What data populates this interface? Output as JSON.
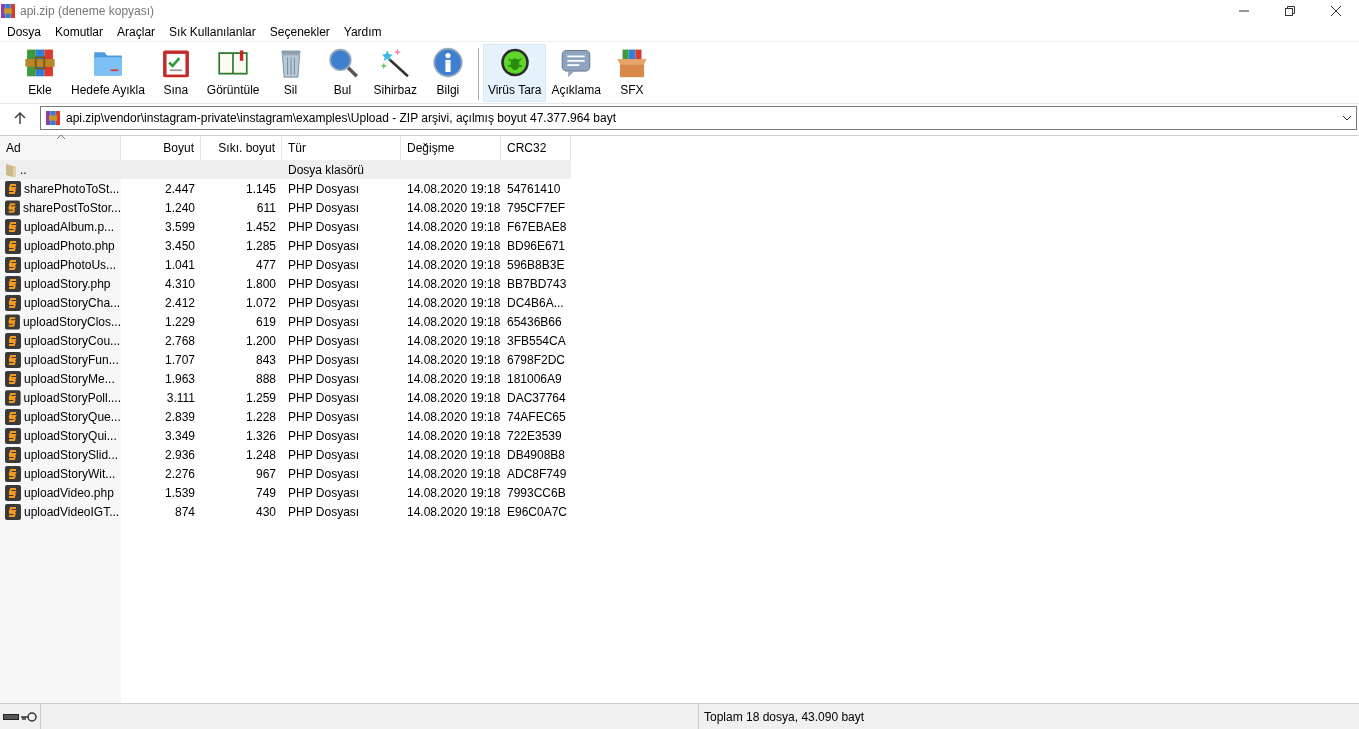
{
  "window": {
    "title": "api.zip (deneme kopyası)"
  },
  "menu": [
    "Dosya",
    "Komutlar",
    "Araçlar",
    "Sık Kullanılanlar",
    "Seçenekler",
    "Yardım"
  ],
  "toolbar": [
    {
      "label": "Ekle",
      "selected": false
    },
    {
      "label": "Hedefe Ayıkla",
      "selected": false
    },
    {
      "label": "Sına",
      "selected": false
    },
    {
      "label": "Görüntüle",
      "selected": false
    },
    {
      "label": "Sil",
      "selected": false
    },
    {
      "label": "Bul",
      "selected": false
    },
    {
      "label": "Sihirbaz",
      "selected": false
    },
    {
      "label": "Bilgi",
      "selected": false
    },
    {
      "label": "Virüs Tara",
      "selected": true
    },
    {
      "label": "Açıklama",
      "selected": false
    },
    {
      "label": "SFX",
      "selected": false
    }
  ],
  "address": {
    "value": "api.zip\\vendor\\instagram-private\\instagram\\examples\\Upload - ZIP arşivi, açılmış boyut 47.377.964 bayt"
  },
  "table": {
    "columns": [
      {
        "label": "Ad",
        "sorted": true
      },
      {
        "label": "Boyut",
        "sorted": false
      },
      {
        "label": "Sıkı. boyut",
        "sorted": false
      },
      {
        "label": "Tür",
        "sorted": false
      },
      {
        "label": "Değişme",
        "sorted": false
      },
      {
        "label": "CRC32",
        "sorted": false
      }
    ],
    "rows": [
      {
        "kind": "folder",
        "selected": true,
        "cells": [
          "..",
          "",
          "",
          "Dosya klasörü",
          "",
          ""
        ]
      },
      {
        "kind": "file",
        "selected": false,
        "cells": [
          "sharePhotoToSt...",
          "2.447",
          "1.145",
          "PHP Dosyası",
          "14.08.2020 19:18",
          "54761410"
        ]
      },
      {
        "kind": "file",
        "selected": false,
        "cells": [
          "sharePostToStor...",
          "1.240",
          "611",
          "PHP Dosyası",
          "14.08.2020 19:18",
          "795CF7EF"
        ]
      },
      {
        "kind": "file",
        "selected": false,
        "cells": [
          "uploadAlbum.p...",
          "3.599",
          "1.452",
          "PHP Dosyası",
          "14.08.2020 19:18",
          "F67EBAE8"
        ]
      },
      {
        "kind": "file",
        "selected": false,
        "cells": [
          "uploadPhoto.php",
          "3.450",
          "1.285",
          "PHP Dosyası",
          "14.08.2020 19:18",
          "BD96E671"
        ]
      },
      {
        "kind": "file",
        "selected": false,
        "cells": [
          "uploadPhotoUs...",
          "1.041",
          "477",
          "PHP Dosyası",
          "14.08.2020 19:18",
          "596B8B3E"
        ]
      },
      {
        "kind": "file",
        "selected": false,
        "cells": [
          "uploadStory.php",
          "4.310",
          "1.800",
          "PHP Dosyası",
          "14.08.2020 19:18",
          "BB7BD743"
        ]
      },
      {
        "kind": "file",
        "selected": false,
        "cells": [
          "uploadStoryCha...",
          "2.412",
          "1.072",
          "PHP Dosyası",
          "14.08.2020 19:18",
          "DC4B6A..."
        ]
      },
      {
        "kind": "file",
        "selected": false,
        "cells": [
          "uploadStoryClos...",
          "1.229",
          "619",
          "PHP Dosyası",
          "14.08.2020 19:18",
          "65436B66"
        ]
      },
      {
        "kind": "file",
        "selected": false,
        "cells": [
          "uploadStoryCou...",
          "2.768",
          "1.200",
          "PHP Dosyası",
          "14.08.2020 19:18",
          "3FB554CA"
        ]
      },
      {
        "kind": "file",
        "selected": false,
        "cells": [
          "uploadStoryFun...",
          "1.707",
          "843",
          "PHP Dosyası",
          "14.08.2020 19:18",
          "6798F2DC"
        ]
      },
      {
        "kind": "file",
        "selected": false,
        "cells": [
          "uploadStoryMe...",
          "1.963",
          "888",
          "PHP Dosyası",
          "14.08.2020 19:18",
          "181006A9"
        ]
      },
      {
        "kind": "file",
        "selected": false,
        "cells": [
          "uploadStoryPoll....",
          "3.111",
          "1.259",
          "PHP Dosyası",
          "14.08.2020 19:18",
          "DAC37764"
        ]
      },
      {
        "kind": "file",
        "selected": false,
        "cells": [
          "uploadStoryQue...",
          "2.839",
          "1.228",
          "PHP Dosyası",
          "14.08.2020 19:18",
          "74AFEC65"
        ]
      },
      {
        "kind": "file",
        "selected": false,
        "cells": [
          "uploadStoryQui...",
          "3.349",
          "1.326",
          "PHP Dosyası",
          "14.08.2020 19:18",
          "722E3539"
        ]
      },
      {
        "kind": "file",
        "selected": false,
        "cells": [
          "uploadStorySlid...",
          "2.936",
          "1.248",
          "PHP Dosyası",
          "14.08.2020 19:18",
          "DB4908B8"
        ]
      },
      {
        "kind": "file",
        "selected": false,
        "cells": [
          "uploadStoryWit...",
          "2.276",
          "967",
          "PHP Dosyası",
          "14.08.2020 19:18",
          "ADC8F749"
        ]
      },
      {
        "kind": "file",
        "selected": false,
        "cells": [
          "uploadVideo.php",
          "1.539",
          "749",
          "PHP Dosyası",
          "14.08.2020 19:18",
          "7993CC6B"
        ]
      },
      {
        "kind": "file",
        "selected": false,
        "cells": [
          "uploadVideoIGT...",
          "874",
          "430",
          "PHP Dosyası",
          "14.08.2020 19:18",
          "E96C0A7C"
        ]
      }
    ]
  },
  "status_bar": {
    "text": "Toplam 18 dosya, 43.090 bayt"
  }
}
